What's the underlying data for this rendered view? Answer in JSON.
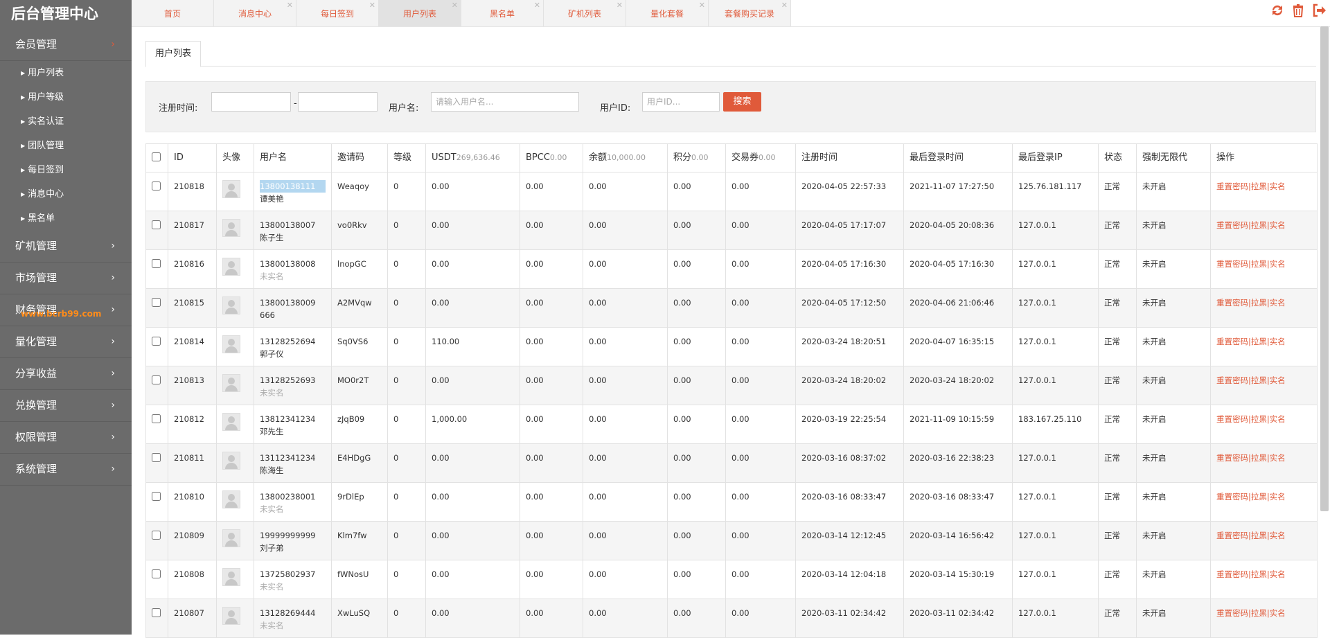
{
  "brand": "后台管理中心",
  "sidebar": {
    "groups": [
      {
        "label": "会员管理",
        "open": true,
        "items": [
          "用户列表",
          "用户等级",
          "实名认证",
          "团队管理",
          "每日签到",
          "消息中心",
          "黑名单"
        ]
      },
      {
        "label": "矿机管理"
      },
      {
        "label": "市场管理"
      },
      {
        "label": "财务管理"
      },
      {
        "label": "量化管理"
      },
      {
        "label": "分享收益"
      },
      {
        "label": "兑换管理"
      },
      {
        "label": "权限管理"
      },
      {
        "label": "系统管理"
      }
    ],
    "watermark": "www.bcrb99.com"
  },
  "tabs": [
    "首页",
    "消息中心",
    "每日签到",
    "用户列表",
    "黑名单",
    "矿机列表",
    "量化套餐",
    "套餐购买记录"
  ],
  "active_tab": "用户列表",
  "page": {
    "subtab": "用户列表",
    "filter": {
      "reg_time_label": "注册时间:",
      "dash": "-",
      "username_label": "用户名:",
      "username_placeholder": "请输入用户名...",
      "userid_label": "用户ID:",
      "userid_placeholder": "用户ID...",
      "search_button": "搜索"
    }
  },
  "table": {
    "headers": {
      "id": "ID",
      "avatar": "头像",
      "username": "用户名",
      "invite": "邀请码",
      "level": "等级",
      "usdt": "USDT",
      "usdt_sum": "269,636.46",
      "bpcc": "BPCC",
      "bpcc_sum": "0.00",
      "balance": "余额",
      "balance_sum": "10,000.00",
      "points": "积分",
      "points_sum": "0.00",
      "voucher": "交易券",
      "voucher_sum": "0.00",
      "reg_time": "注册时间",
      "last_login": "最后登录时间",
      "last_ip": "最后登录IP",
      "status": "状态",
      "force": "强制无限代",
      "ops": "操作"
    },
    "op_links": {
      "reset": "重置密码",
      "block": "拉黑",
      "realname": "实名",
      "sep": "|"
    },
    "rows": [
      {
        "id": "210818",
        "phone": "13800138111",
        "name": "谭美艳",
        "invite": "Weaqoy",
        "level": "0",
        "usdt": "0.00",
        "bpcc": "0.00",
        "balance": "0.00",
        "points": "0.00",
        "voucher": "0.00",
        "reg": "2020-04-05 22:57:33",
        "login": "2021-11-07 17:27:50",
        "ip": "125.76.181.117",
        "status": "正常",
        "force": "未开启"
      },
      {
        "id": "210817",
        "phone": "13800138007",
        "name": "陈子生",
        "invite": "vo0Rkv",
        "level": "0",
        "usdt": "0.00",
        "bpcc": "0.00",
        "balance": "0.00",
        "points": "0.00",
        "voucher": "0.00",
        "reg": "2020-04-05 17:17:07",
        "login": "2020-04-05 20:08:36",
        "ip": "127.0.0.1",
        "status": "正常",
        "force": "未开启"
      },
      {
        "id": "210816",
        "phone": "13800138008",
        "name": "未实名",
        "invite": "lnopGC",
        "level": "0",
        "usdt": "0.00",
        "bpcc": "0.00",
        "balance": "0.00",
        "points": "0.00",
        "voucher": "0.00",
        "reg": "2020-04-05 17:16:30",
        "login": "2020-04-05 17:16:30",
        "ip": "127.0.0.1",
        "status": "正常",
        "force": "未开启"
      },
      {
        "id": "210815",
        "phone": "13800138009",
        "name": "666",
        "invite": "A2MVqw",
        "level": "0",
        "usdt": "0.00",
        "bpcc": "0.00",
        "balance": "0.00",
        "points": "0.00",
        "voucher": "0.00",
        "reg": "2020-04-05 17:12:50",
        "login": "2020-04-06 21:06:46",
        "ip": "127.0.0.1",
        "status": "正常",
        "force": "未开启"
      },
      {
        "id": "210814",
        "phone": "13128252694",
        "name": "郭子仪",
        "invite": "Sq0VS6",
        "level": "0",
        "usdt": "110.00",
        "bpcc": "0.00",
        "balance": "0.00",
        "points": "0.00",
        "voucher": "0.00",
        "reg": "2020-03-24 18:20:51",
        "login": "2020-04-07 16:35:15",
        "ip": "127.0.0.1",
        "status": "正常",
        "force": "未开启"
      },
      {
        "id": "210813",
        "phone": "13128252693",
        "name": "未实名",
        "invite": "MO0r2T",
        "level": "0",
        "usdt": "0.00",
        "bpcc": "0.00",
        "balance": "0.00",
        "points": "0.00",
        "voucher": "0.00",
        "reg": "2020-03-24 18:20:02",
        "login": "2020-03-24 18:20:02",
        "ip": "127.0.0.1",
        "status": "正常",
        "force": "未开启"
      },
      {
        "id": "210812",
        "phone": "13812341234",
        "name": "邓先生",
        "invite": "zJqB09",
        "level": "0",
        "usdt": "1,000.00",
        "bpcc": "0.00",
        "balance": "0.00",
        "points": "0.00",
        "voucher": "0.00",
        "reg": "2020-03-19 22:25:54",
        "login": "2021-11-09 10:15:59",
        "ip": "183.167.25.110",
        "status": "正常",
        "force": "未开启"
      },
      {
        "id": "210811",
        "phone": "13112341234",
        "name": "陈海生",
        "invite": "E4HDgG",
        "level": "0",
        "usdt": "0.00",
        "bpcc": "0.00",
        "balance": "0.00",
        "points": "0.00",
        "voucher": "0.00",
        "reg": "2020-03-16 08:37:02",
        "login": "2020-03-16 22:38:23",
        "ip": "127.0.0.1",
        "status": "正常",
        "force": "未开启"
      },
      {
        "id": "210810",
        "phone": "13800238001",
        "name": "未实名",
        "invite": "9rDlEp",
        "level": "0",
        "usdt": "0.00",
        "bpcc": "0.00",
        "balance": "0.00",
        "points": "0.00",
        "voucher": "0.00",
        "reg": "2020-03-16 08:33:47",
        "login": "2020-03-16 08:33:47",
        "ip": "127.0.0.1",
        "status": "正常",
        "force": "未开启"
      },
      {
        "id": "210809",
        "phone": "19999999999",
        "name": "刘子弟",
        "invite": "Klm7fw",
        "level": "0",
        "usdt": "0.00",
        "bpcc": "0.00",
        "balance": "0.00",
        "points": "0.00",
        "voucher": "0.00",
        "reg": "2020-03-14 12:12:45",
        "login": "2020-03-14 16:56:42",
        "ip": "127.0.0.1",
        "status": "正常",
        "force": "未开启"
      },
      {
        "id": "210808",
        "phone": "13725802937",
        "name": "未实名",
        "invite": "fWNosU",
        "level": "0",
        "usdt": "0.00",
        "bpcc": "0.00",
        "balance": "0.00",
        "points": "0.00",
        "voucher": "0.00",
        "reg": "2020-03-14 12:04:18",
        "login": "2020-03-14 15:30:19",
        "ip": "127.0.0.1",
        "status": "正常",
        "force": "未开启"
      },
      {
        "id": "210807",
        "phone": "13128269444",
        "name": "未实名",
        "invite": "XwLuSQ",
        "level": "0",
        "usdt": "0.00",
        "bpcc": "0.00",
        "balance": "0.00",
        "points": "0.00",
        "voucher": "0.00",
        "reg": "2020-03-11 02:34:42",
        "login": "2020-03-11 02:34:42",
        "ip": "127.0.0.1",
        "status": "正常",
        "force": "未开启"
      }
    ]
  },
  "colors": {
    "accent": "#e05a3a",
    "sidebar_bg": "#6b6b6b",
    "watermark": "#ff8c1a"
  },
  "icons": [
    "refresh-icon",
    "trash-icon",
    "logout-icon"
  ]
}
